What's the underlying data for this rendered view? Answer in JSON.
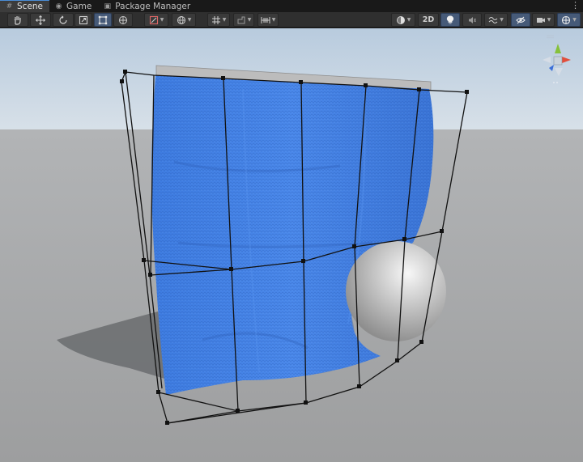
{
  "tabs": [
    {
      "label": "Scene",
      "icon": "hash-icon",
      "active": true
    },
    {
      "label": "Game",
      "icon": "gamepad-icon",
      "active": false
    },
    {
      "label": "Package Manager",
      "icon": "package-icon",
      "active": false
    }
  ],
  "toolbar": {
    "tools": [
      "hand-tool",
      "move-tool",
      "rotate-tool",
      "scale-tool",
      "rect-tool",
      "transform-tool"
    ],
    "active_tool": "rect-tool",
    "mode_2d_label": "2D"
  },
  "scene": {
    "cloth_color": "#3f7fe0",
    "sphere_color": "#c9c9c9",
    "sky_color": "#b9cde0",
    "ground_color": "#a8a8a8"
  }
}
